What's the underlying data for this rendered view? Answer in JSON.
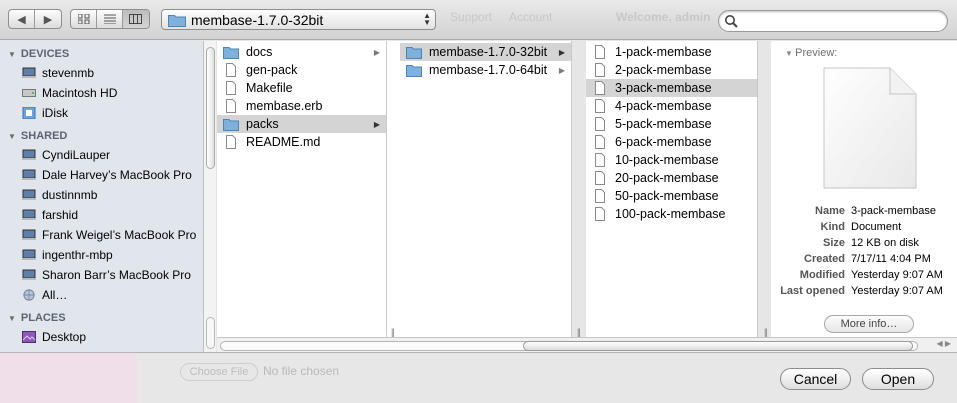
{
  "toolbar": {
    "path_label": "membase-1.7.0-32bit",
    "bg_links": [
      "Support",
      "Account",
      "Welcome, admin"
    ],
    "search_placeholder": ""
  },
  "sidebar": {
    "sections": [
      {
        "title": "DEVICES",
        "items": [
          {
            "label": "stevenmb",
            "icon": "computer-icon"
          },
          {
            "label": "Macintosh HD",
            "icon": "hard-drive-icon"
          },
          {
            "label": "iDisk",
            "icon": "idisk-icon"
          }
        ]
      },
      {
        "title": "SHARED",
        "items": [
          {
            "label": "CyndiLauper",
            "icon": "computer-icon"
          },
          {
            "label": "Dale Harvey’s MacBook Pro",
            "icon": "computer-icon"
          },
          {
            "label": "dustinnmb",
            "icon": "computer-icon"
          },
          {
            "label": "farshid",
            "icon": "computer-icon"
          },
          {
            "label": "Frank Weigel’s MacBook Pro",
            "icon": "computer-icon"
          },
          {
            "label": "ingenthr-mbp",
            "icon": "computer-icon"
          },
          {
            "label": "Sharon Barr’s MacBook Pro",
            "icon": "computer-icon"
          },
          {
            "label": "All…",
            "icon": "network-icon"
          }
        ]
      },
      {
        "title": "PLACES",
        "items": [
          {
            "label": "Desktop",
            "icon": "desktop-icon"
          }
        ]
      }
    ]
  },
  "columns": {
    "col1": [
      {
        "label": "docs",
        "type": "folder"
      },
      {
        "label": "gen-pack",
        "type": "file"
      },
      {
        "label": "Makefile",
        "type": "file"
      },
      {
        "label": "membase.erb",
        "type": "file"
      },
      {
        "label": "packs",
        "type": "folder",
        "selected": true
      },
      {
        "label": "README.md",
        "type": "file"
      }
    ],
    "col2": [
      {
        "label": "membase-1.7.0-32bit",
        "type": "folder",
        "selected": true
      },
      {
        "label": "membase-1.7.0-64bit",
        "type": "folder"
      }
    ],
    "col3": [
      {
        "label": "1-pack-membase",
        "type": "file"
      },
      {
        "label": "2-pack-membase",
        "type": "file"
      },
      {
        "label": "3-pack-membase",
        "type": "file",
        "selected": true
      },
      {
        "label": "4-pack-membase",
        "type": "file"
      },
      {
        "label": "5-pack-membase",
        "type": "file"
      },
      {
        "label": "6-pack-membase",
        "type": "file"
      },
      {
        "label": "10-pack-membase",
        "type": "file"
      },
      {
        "label": "20-pack-membase",
        "type": "file"
      },
      {
        "label": "50-pack-membase",
        "type": "file"
      },
      {
        "label": "100-pack-membase",
        "type": "file"
      }
    ]
  },
  "preview": {
    "header": "Preview:",
    "info": [
      {
        "key": "Name",
        "value": "3-pack-membase"
      },
      {
        "key": "Kind",
        "value": "Document"
      },
      {
        "key": "Size",
        "value": "12 KB on disk"
      },
      {
        "key": "Created",
        "value": "7/17/11 4:04 PM"
      },
      {
        "key": "Modified",
        "value": "Yesterday 9:07 AM"
      },
      {
        "key": "Last opened",
        "value": "Yesterday 9:07 AM"
      }
    ],
    "more_info_label": "More info…"
  },
  "bottom": {
    "choose_file_label": "Choose File",
    "no_file_text": "No file chosen",
    "cancel_label": "Cancel",
    "open_label": "Open"
  },
  "colors": {
    "sidebar_bg": "#e1e6ed",
    "selection_gray": "#d4d4d4",
    "folder_blue": "#7fb1dd"
  }
}
